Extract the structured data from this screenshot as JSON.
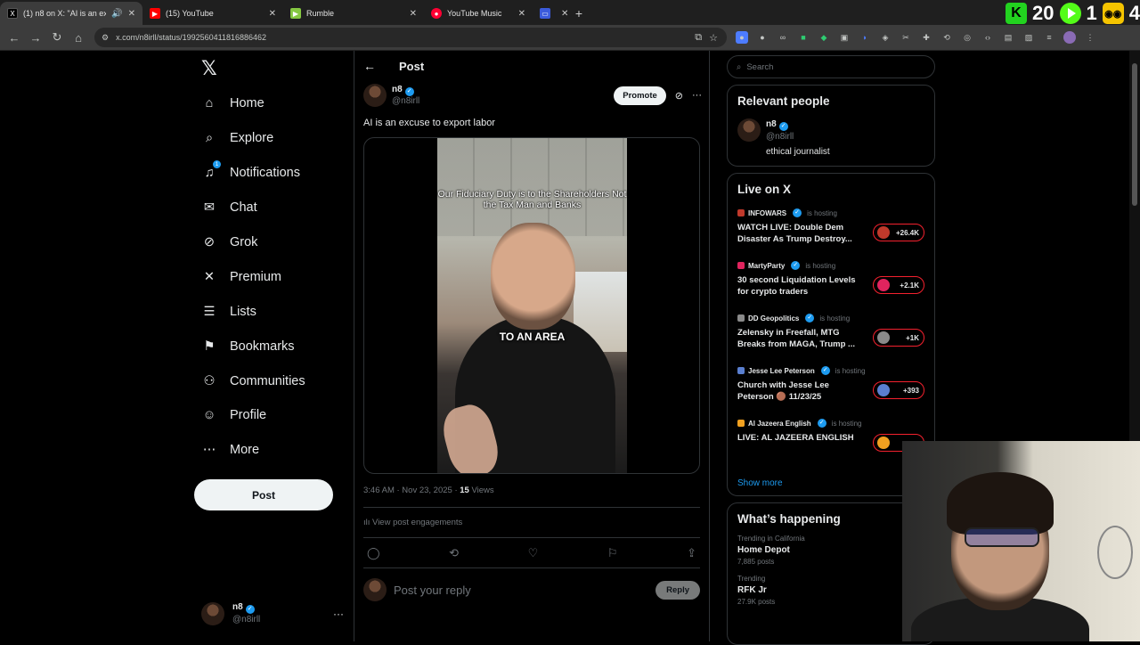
{
  "browser": {
    "tabs": [
      {
        "title": "(1) n8 on X: \"AI is an excuse",
        "favicon": "X",
        "fav_color": "#000000",
        "active": true
      },
      {
        "title": "(15) YouTube",
        "favicon": "▶",
        "fav_color": "#ff0000",
        "active": false
      },
      {
        "title": "Rumble",
        "favicon": "▶",
        "fav_color": "#85c742",
        "active": false
      },
      {
        "title": "YouTube Music",
        "favicon": "●",
        "fav_color": "#ff0033",
        "active": false
      },
      {
        "title": "",
        "favicon": "▭",
        "fav_color": "#3b5bdb",
        "active": false
      }
    ],
    "url": "x.com/n8irll/status/1992560411816886462"
  },
  "stream_overlay": {
    "k_count": "20",
    "play_count": "1",
    "yellow_count": "4"
  },
  "left_nav": {
    "items": [
      {
        "label": "Home",
        "icon": "home-icon",
        "glyph": "⌂"
      },
      {
        "label": "Explore",
        "icon": "search-icon",
        "glyph": "⌕"
      },
      {
        "label": "Notifications",
        "icon": "bell-icon",
        "glyph": "♫"
      },
      {
        "label": "Chat",
        "icon": "mail-icon",
        "glyph": "✉"
      },
      {
        "label": "Grok",
        "icon": "grok-icon",
        "glyph": "⊘"
      },
      {
        "label": "Premium",
        "icon": "x-premium-icon",
        "glyph": "✕"
      },
      {
        "label": "Lists",
        "icon": "list-icon",
        "glyph": "☰"
      },
      {
        "label": "Bookmarks",
        "icon": "bookmark-icon",
        "glyph": "⚑"
      },
      {
        "label": "Communities",
        "icon": "communities-icon",
        "glyph": "⚇"
      },
      {
        "label": "Profile",
        "icon": "person-icon",
        "glyph": "☺"
      },
      {
        "label": "More",
        "icon": "more-circle-icon",
        "glyph": "⋯"
      }
    ],
    "notification_badge": "1",
    "post_button": "Post",
    "account": {
      "name": "n8",
      "handle": "@n8irll"
    }
  },
  "post": {
    "header_title": "Post",
    "author_name": "n8",
    "author_handle": "@n8irll",
    "promote_label": "Promote",
    "text": "AI is an excuse to export labor",
    "video_caption_top": "Our Fiduciary Duty is to the Shareholders Not the Tax Man and Banks",
    "video_caption_mid": "TO AN AREA",
    "timestamp": "3:46 AM · Nov 23, 2025 · ",
    "views_count": "15",
    "views_label": " Views",
    "engagements_label": "View post engagements",
    "reply_placeholder": "Post your reply",
    "reply_button": "Reply"
  },
  "sidebar": {
    "search_placeholder": "Search",
    "relevant": {
      "title": "Relevant people",
      "name": "n8",
      "handle": "@n8irll",
      "bio": "ethical journalist"
    },
    "live": {
      "title": "Live on X",
      "items": [
        {
          "host": "INFOWARS",
          "hosting": "is hosting",
          "title": "WATCH LIVE: Double Dem Disaster As Trump Destroy...",
          "count": "+26.4K",
          "color": "#c0392b"
        },
        {
          "host": "MartyParty",
          "hosting": "is hosting",
          "title": "30 second Liquidation Levels for crypto traders",
          "count": "+2.1K",
          "color": "#e0245e"
        },
        {
          "host": "DD Geopolitics",
          "hosting": "is hosting",
          "title": "Zelensky in Freefall, MTG Breaks from MAGA, Trump ...",
          "count": "+1K",
          "color": "#8a8a8a"
        },
        {
          "host": "Jesse Lee Peterson",
          "hosting": "is hosting",
          "title": "Church with Jesse Lee Peterson 🟤 11/23/25",
          "count": "+393",
          "color": "#5a7fd0"
        },
        {
          "host": "Al Jazeera English",
          "hosting": "is hosting",
          "title": "LIVE: AL JAZEERA ENGLISH",
          "count": "",
          "color": "#f0a020"
        }
      ],
      "show_more": "Show more"
    },
    "happening": {
      "title": "What’s happening",
      "trends": [
        {
          "context": "Trending in California",
          "name": "Home Depot",
          "posts": "7,885 posts"
        },
        {
          "context": "Trending",
          "name": "RFK Jr",
          "posts": "27.9K posts"
        }
      ]
    }
  },
  "colors": {
    "accent": "#1d9bf0",
    "live_red": "#f4212e",
    "background": "#000000"
  }
}
